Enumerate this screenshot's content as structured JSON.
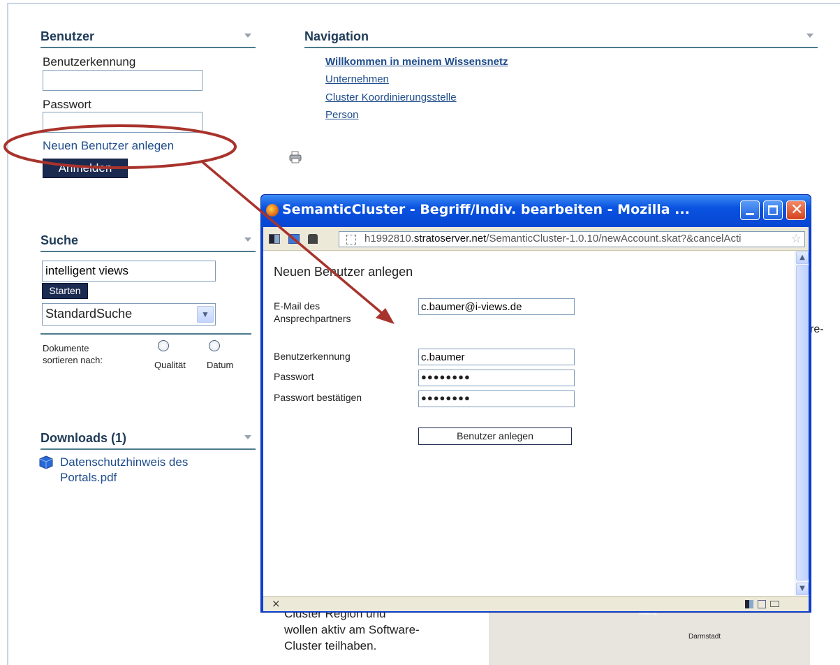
{
  "login": {
    "heading": "Benutzer",
    "username_label": "Benutzerkennung",
    "username_value": "",
    "password_label": "Passwort",
    "password_value": "",
    "new_user_link": "Neuen Benutzer anlegen",
    "login_button": "Anmelden"
  },
  "navigation": {
    "heading": "Navigation",
    "items": [
      "Willkommen in meinem Wissensnetz",
      "Unternehmen",
      "Cluster Koordinierungsstelle",
      "Person"
    ]
  },
  "search": {
    "heading": "Suche",
    "query": "intelligent views",
    "start_button": "Starten",
    "mode_selected": "StandardSuche",
    "sort_label": "Dokumente sortieren nach:",
    "sort_options": [
      "Qualität",
      "Datum"
    ]
  },
  "downloads": {
    "heading": "Downloads (1)",
    "file": "Datenschutzhinweis des Portals.pdf"
  },
  "page_text": {
    "partial_right": "re-",
    "bottom_line1": "Cluster Region und",
    "bottom_line2": "wollen aktiv am Software-",
    "bottom_line3": "Cluster teilhaben.",
    "map_city1": "Mainz",
    "map_city2": "Darmstadt"
  },
  "popup": {
    "window_title": "SemanticCluster - Begriff/Indiv. bearbeiten - Mozilla ...",
    "url_prefix": "h1992810.",
    "url_domain": "stratoserver.net",
    "url_path": "/SemanticCluster-1.0.10/newAccount.skat?&cancelActi",
    "form_title": "Neuen Benutzer anlegen",
    "email_label": "E-Mail des Ansprechpartners",
    "email_value": "c.baumer@i-views.de",
    "username_label": "Benutzerkennung",
    "username_value": "c.baumer",
    "password_label": "Passwort",
    "password_value": "●●●●●●●●",
    "password_confirm_label": "Passwort bestätigen",
    "password_confirm_value": "●●●●●●●●",
    "submit_button": "Benutzer anlegen",
    "status_close": "×"
  },
  "colors": {
    "annotation": "#a8332c",
    "header_blue": "#1f3b57",
    "link_blue": "#1f4d8c",
    "titlebar_blue": "#0a52e0"
  }
}
